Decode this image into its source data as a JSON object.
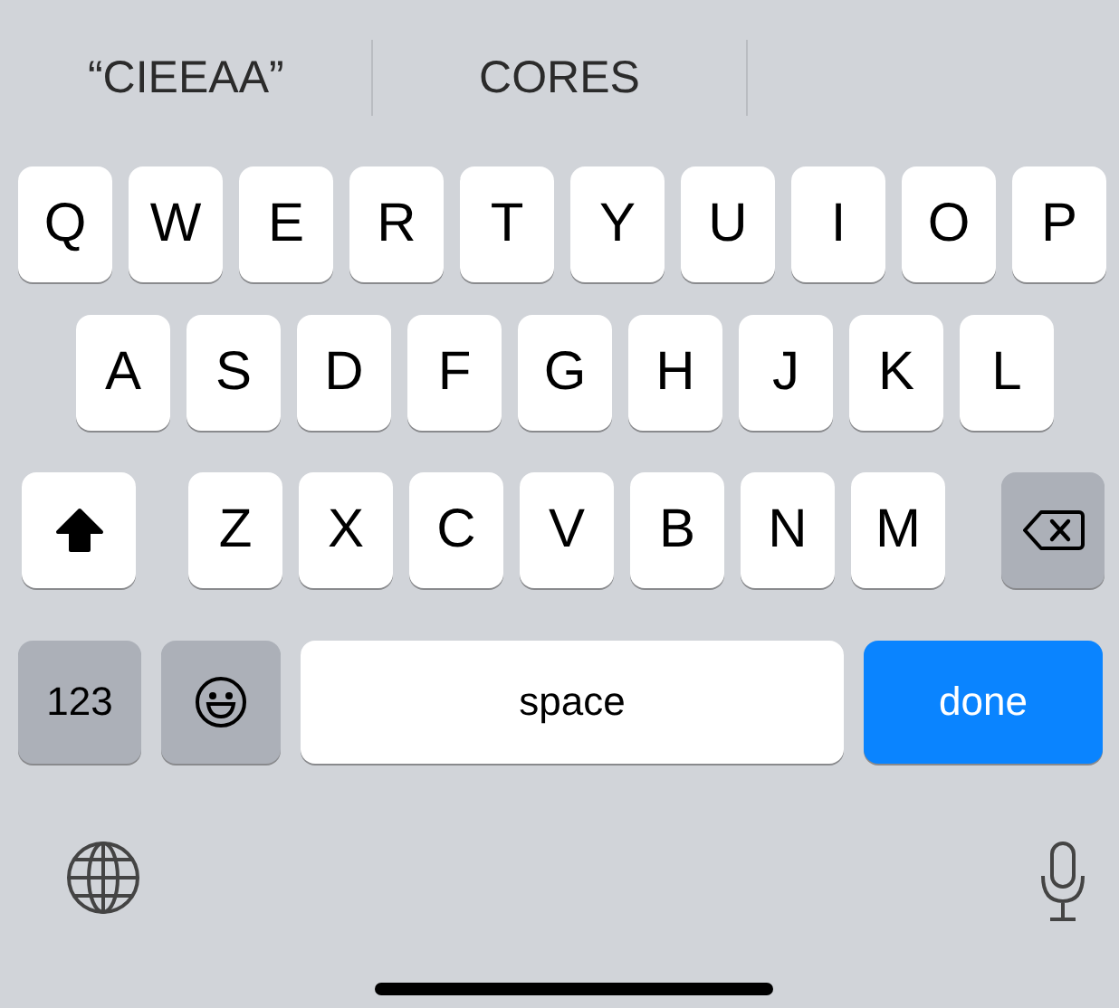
{
  "suggestions": [
    {
      "text": "“CIEEAA”"
    },
    {
      "text": "CORES"
    }
  ],
  "rows": [
    [
      "Q",
      "W",
      "E",
      "R",
      "T",
      "Y",
      "U",
      "I",
      "O",
      "P"
    ],
    [
      "A",
      "S",
      "D",
      "F",
      "G",
      "H",
      "J",
      "K",
      "L"
    ],
    [
      "Z",
      "X",
      "C",
      "V",
      "B",
      "N",
      "M"
    ]
  ],
  "shift": {
    "on": true
  },
  "bottom_row": [
    {
      "kind": "numbers",
      "label": "123"
    },
    {
      "kind": "emoji"
    },
    {
      "kind": "space",
      "label": "space"
    },
    {
      "kind": "return",
      "label": "done"
    }
  ]
}
